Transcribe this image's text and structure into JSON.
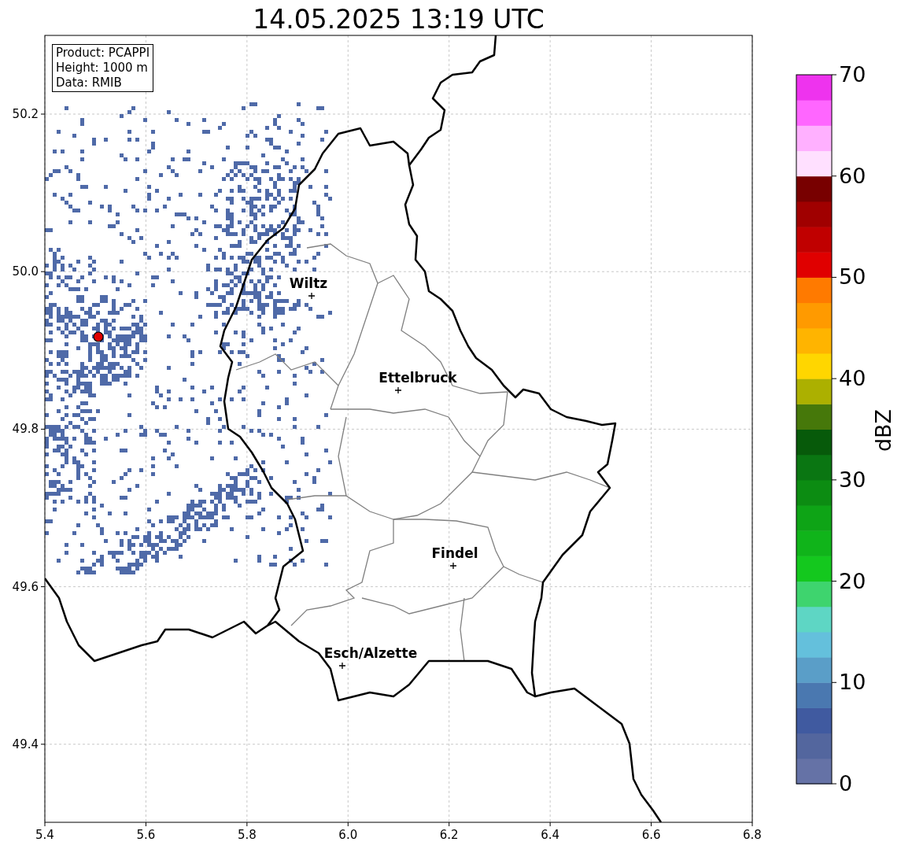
{
  "title": "14.05.2025 13:19 UTC",
  "info_box": [
    "Product: PCAPPI",
    "Height: 1000 m",
    "Data: RMIB"
  ],
  "map": {
    "y_ticks": [
      "50.2",
      "50.0",
      "49.8",
      "49.6",
      "49.4"
    ],
    "x_ticks": [
      "5.4",
      "5.6",
      "5.8",
      "6.0",
      "6.2",
      "6.4",
      "6.6",
      "6.8"
    ],
    "places": [
      {
        "name": "Wiltz"
      },
      {
        "name": "Ettelbruck"
      },
      {
        "name": "Findel"
      },
      {
        "name": "Esch/Alzette"
      }
    ]
  },
  "colorbar": {
    "label": "dBZ",
    "ticks": [
      "70",
      "60",
      "50",
      "40",
      "30",
      "20",
      "10",
      "0"
    ],
    "segments": [
      {
        "color": "#6572a6"
      },
      {
        "color": "#53669e"
      },
      {
        "color": "#405aa0"
      },
      {
        "color": "#4a78b0"
      },
      {
        "color": "#5a9ec8"
      },
      {
        "color": "#64c0dc"
      },
      {
        "color": "#5ed6c4"
      },
      {
        "color": "#3ed46e"
      },
      {
        "color": "#14c81e"
      },
      {
        "color": "#10b41a"
      },
      {
        "color": "#0ea416"
      },
      {
        "color": "#0c8c12"
      },
      {
        "color": "#0a7612"
      },
      {
        "color": "#075a0a"
      },
      {
        "color": "#46780a"
      },
      {
        "color": "#acb000"
      },
      {
        "color": "#ffd600"
      },
      {
        "color": "#ffb400"
      },
      {
        "color": "#ff9a00"
      },
      {
        "color": "#ff7a00"
      },
      {
        "color": "#e00000"
      },
      {
        "color": "#c00000"
      },
      {
        "color": "#a00000"
      },
      {
        "color": "#780000"
      },
      {
        "color": "#ffe0ff"
      },
      {
        "color": "#ffb0ff"
      },
      {
        "color": "#ff66ff"
      },
      {
        "color": "#ee33ee"
      }
    ]
  }
}
